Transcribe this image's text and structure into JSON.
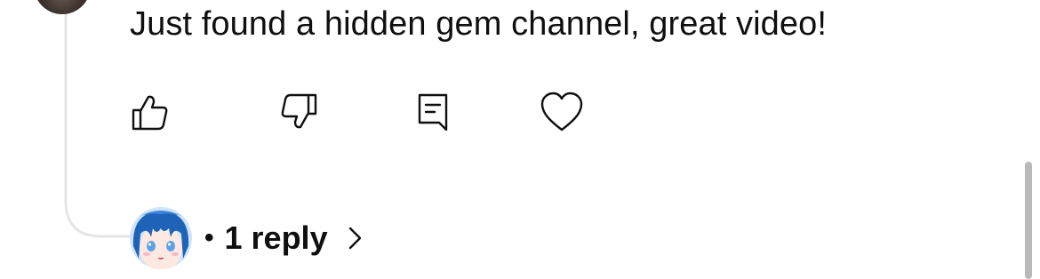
{
  "comment": {
    "text": "Just found a hidden gem channel, great video!"
  },
  "actions": {
    "like_icon": "thumbs-up-icon",
    "dislike_icon": "thumbs-down-icon",
    "reply_icon": "comment-reply-icon",
    "heart_icon": "heart-icon"
  },
  "replies": {
    "separator": "•",
    "count_label": "1 reply",
    "chevron_icon": "chevron-right-icon"
  },
  "colors": {
    "text": "#0f0f0f",
    "thread_line": "#e5e5e5",
    "scrollbar": "#b9b9b9"
  }
}
